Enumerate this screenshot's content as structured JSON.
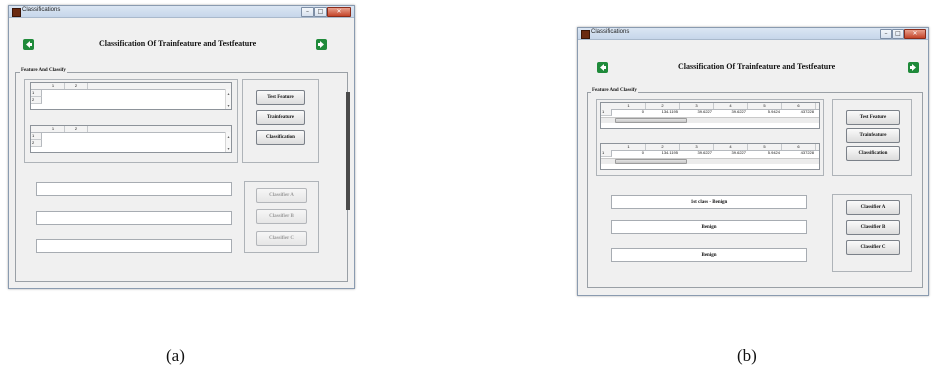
{
  "window_title": "Classifications",
  "heading": "Classification Of Trainfeature and Testfeature",
  "panel_label": "Feature And Classify",
  "buttons": {
    "test_feature": "Test Feature",
    "trainfeature": "Trainfeature",
    "classification": "Classification",
    "classifier_a": "Classifier A",
    "classifier_b": "Classifier B",
    "classifier_c": "Classifier C"
  },
  "panel_a": {
    "caption": "(a)",
    "table1": {
      "columns": [
        "1",
        "2"
      ],
      "rows": [
        "1",
        "2"
      ]
    },
    "table2": {
      "columns": [
        "1",
        "2"
      ],
      "rows": [
        "1",
        "2"
      ]
    },
    "results": [
      "",
      "",
      ""
    ],
    "classifier_buttons_enabled": false
  },
  "panel_b": {
    "caption": "(b)",
    "table1": {
      "columns": [
        "1",
        "2",
        "3",
        "4",
        "5",
        "6"
      ],
      "rows": [
        "1"
      ],
      "values": [
        "0",
        "134.1195",
        "39.6227",
        "39.6227",
        "5.9424",
        "437228"
      ]
    },
    "table2": {
      "columns": [
        "1",
        "2",
        "3",
        "4",
        "5",
        "6"
      ],
      "rows": [
        "1"
      ],
      "values": [
        "0",
        "134.1195",
        "39.6227",
        "39.6227",
        "5.9424",
        "437228"
      ]
    },
    "results": [
      "1st class - Benign",
      "Benign",
      "Benign"
    ],
    "classifier_buttons_enabled": true
  },
  "icons": {
    "back": "arrow-left-icon",
    "forward": "arrow-right-icon",
    "app": "matlab-figure-icon"
  },
  "colors": {
    "arrow_green": "#1f8a3a",
    "close_red": "#c4442a"
  }
}
